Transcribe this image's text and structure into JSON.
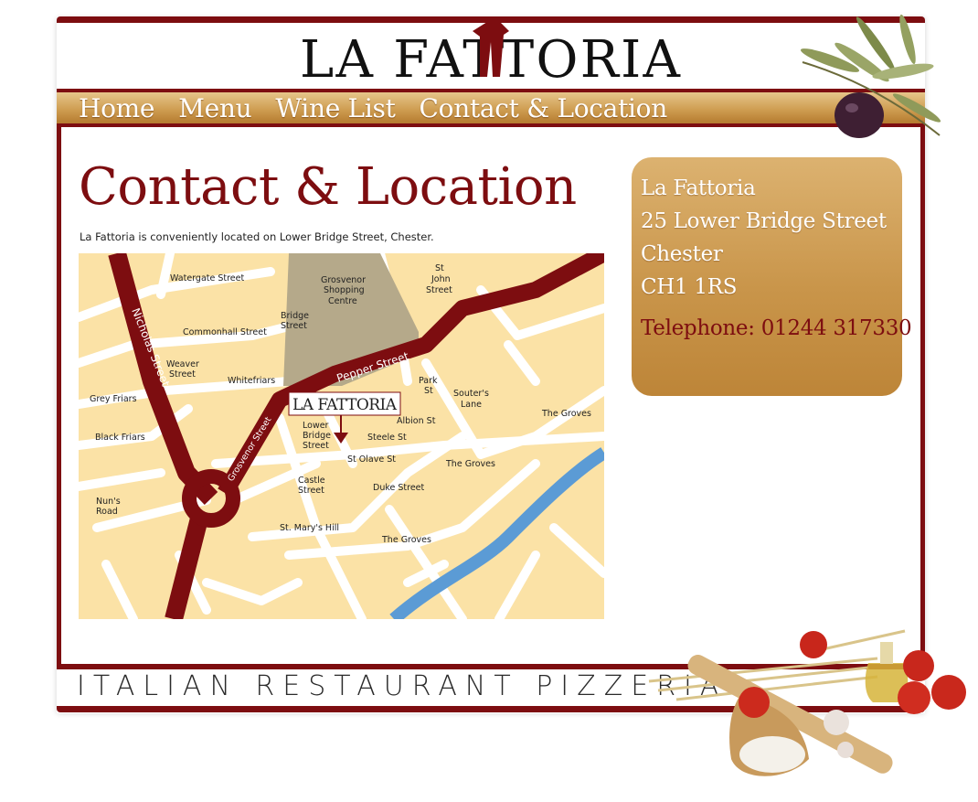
{
  "brand": {
    "logo_text": "LA FATTORIA",
    "tagline": "ITALIAN RESTAURANT PIZZERIA"
  },
  "nav": {
    "items": [
      "Home",
      "Menu",
      "Wine List",
      "Contact & Location"
    ]
  },
  "page": {
    "title": "Contact & Location",
    "intro": "La Fattoria is conveniently located on Lower Bridge Street, Chester."
  },
  "map": {
    "labels": {
      "watergate": "Watergate Street",
      "grosvenor_sc_1": "Grosvenor",
      "grosvenor_sc_2": "Shopping",
      "grosvenor_sc_3": "Centre",
      "st_john_1": "St",
      "st_john_2": "John",
      "st_john_3": "Street",
      "nicholas": "Nicholas Street",
      "bridge_1": "Bridge",
      "bridge_2": "Street",
      "commonhall": "Commonhall Street",
      "pepper": "Pepper Street",
      "weaver_1": "Weaver",
      "weaver_2": "Street",
      "whitefriars": "Whitefriars",
      "park_1": "Park",
      "park_2": "St",
      "souters_1": "Souter's",
      "souters_2": "Lane",
      "greyfriars": "Grey Friars",
      "albion": "Albion St",
      "groves_1": "The Groves",
      "lower_bridge_1": "Lower",
      "lower_bridge_2": "Bridge",
      "lower_bridge_3": "Street",
      "steele": "Steele St",
      "blackfriars": "Black Friars",
      "grosvenor_st": "Grosvenor Street",
      "st_olave": "St Olave St",
      "groves_2": "The Groves",
      "castle_1": "Castle",
      "castle_2": "Street",
      "duke": "Duke Street",
      "nuns_1": "Nun's",
      "nuns_2": "Road",
      "st_marys": "St. Mary's Hill",
      "groves_3": "The Groves",
      "marker_logo": "LA FATTORIA"
    }
  },
  "contact": {
    "name": "La Fattoria",
    "street": "25 Lower Bridge Street",
    "city": "Chester",
    "postcode": "CH1 1RS",
    "phone": "Telephone: 01244 317330"
  },
  "colors": {
    "brand_red": "#7d0d10",
    "gold": "#c9954a",
    "map_bg": "#fbe2a6",
    "river": "#5b9bd5",
    "mall": "#b5a98a"
  }
}
